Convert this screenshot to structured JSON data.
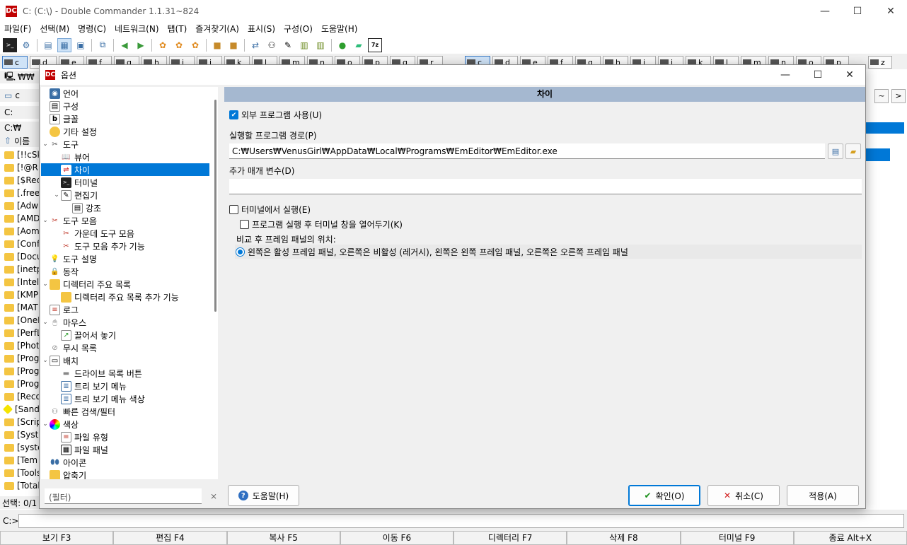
{
  "window": {
    "title": "C: (C:\\) - Double Commander 1.1.31~824",
    "minimize": "—",
    "maximize": "☐",
    "close": "✕"
  },
  "menu": [
    "파일(F)",
    "선택(M)",
    "명령(C)",
    "네트워크(N)",
    "탭(T)",
    "즐겨찾기(A)",
    "표시(S)",
    "구성(O)",
    "도움말(H)"
  ],
  "drives_left": [
    "c",
    "d",
    "e",
    "f",
    "g",
    "h",
    "i",
    "j",
    "k",
    "l",
    "m",
    "n",
    "o",
    "p",
    "q",
    "r",
    "s",
    "z"
  ],
  "drives_right": [
    "c",
    "d",
    "e",
    "f",
    "g",
    "h",
    "i",
    "j",
    "k",
    "l",
    "m",
    "n",
    "o",
    "p",
    "q",
    "r",
    "z"
  ],
  "left_panel": {
    "net_label": "₩₩",
    "drive_label": "c",
    "path_drive": "C:",
    "path": "C:₩",
    "column_name": "이름",
    "rows": [
      "[!!cSk",
      "[!@RI",
      "[$Rec",
      "[.free",
      "[Adw",
      "[AMD",
      "[Aom",
      "[Conf",
      "[Docu",
      "[inetp",
      "[Intel",
      "[KMP",
      "[MAT",
      "[OneI",
      "[PerfL",
      "[Phot",
      "[Prog",
      "[Prog",
      "[Prog",
      "[Reco",
      "[Sand",
      "[Scrip",
      "[Syste",
      "[syste",
      "[Tem",
      "[Tools",
      "[Total"
    ],
    "status": "선택: 0/1"
  },
  "dialog": {
    "title": "옵션",
    "minimize": "—",
    "maximize": "☐",
    "close": "✕",
    "tree": [
      {
        "label": "언어",
        "level": 0,
        "icon": "globe"
      },
      {
        "label": "구성",
        "level": 0,
        "icon": "doc"
      },
      {
        "label": "글꼴",
        "level": 0,
        "icon": "font"
      },
      {
        "label": "기타 설정",
        "level": 0,
        "icon": "misc"
      },
      {
        "label": "도구",
        "level": 0,
        "icon": "tools",
        "expanded": true
      },
      {
        "label": "뷰어",
        "level": 1,
        "icon": "book"
      },
      {
        "label": "차이",
        "level": 1,
        "icon": "diff",
        "selected": true
      },
      {
        "label": "터미널",
        "level": 1,
        "icon": "terminal"
      },
      {
        "label": "편집기",
        "level": 1,
        "icon": "edit",
        "expanded": true
      },
      {
        "label": "강조",
        "level": 2,
        "icon": "doc"
      },
      {
        "label": "도구 모음",
        "level": 0,
        "icon": "scissors",
        "expanded": true
      },
      {
        "label": "가운데 도구 모음",
        "level": 1,
        "icon": "scissors"
      },
      {
        "label": "도구 모음 추가 기능",
        "level": 1,
        "icon": "scissors"
      },
      {
        "label": "도구 설명",
        "level": 0,
        "icon": "bulb"
      },
      {
        "label": "동작",
        "level": 0,
        "icon": "lock"
      },
      {
        "label": "디렉터리 주요 목록",
        "level": 0,
        "icon": "folder",
        "expanded": true
      },
      {
        "label": "디렉터리 주요 목록 추가 기능",
        "level": 1,
        "icon": "folder"
      },
      {
        "label": "로그",
        "level": 0,
        "icon": "log"
      },
      {
        "label": "마우스",
        "level": 0,
        "icon": "mouse",
        "expanded": true
      },
      {
        "label": "끌어서 놓기",
        "level": 1,
        "icon": "drag"
      },
      {
        "label": "무시 목록",
        "level": 0,
        "icon": "ignore"
      },
      {
        "label": "배치",
        "level": 0,
        "icon": "layout",
        "expanded": true
      },
      {
        "label": "드라이브 목록 버튼",
        "level": 1,
        "icon": "drive"
      },
      {
        "label": "트리 보기 메뉴",
        "level": 1,
        "icon": "tree"
      },
      {
        "label": "트리 보기 메뉴 색상",
        "level": 1,
        "icon": "tree"
      },
      {
        "label": "빠른 검색/필터",
        "level": 0,
        "icon": "binoculars"
      },
      {
        "label": "색상",
        "level": 0,
        "icon": "colors",
        "expanded": true
      },
      {
        "label": "파일 유형",
        "level": 1,
        "icon": "filetype"
      },
      {
        "label": "파일 패널",
        "level": 1,
        "icon": "panel"
      },
      {
        "label": "아이콘",
        "level": 0,
        "icon": "icons"
      },
      {
        "label": "압축기",
        "level": 0,
        "icon": "archive"
      }
    ],
    "filter_placeholder": "(필터)",
    "help_button": "도움말(H)",
    "ok_button": "확인(O)",
    "cancel_button": "취소(C)",
    "apply_button": "적용(A)",
    "pane": {
      "header": "차이",
      "use_external": {
        "label": "외부 프로그램 사용(U)",
        "checked": true
      },
      "path_label": "실행할 프로그램 경로(P)",
      "path_value": "C:₩Users₩VenusGirl₩AppData₩Local₩Programs₩EmEditor₩EmEditor.exe",
      "params_label": "추가 매개 변수(D)",
      "params_value": "",
      "run_in_terminal": {
        "label": "터미널에서 실행(E)",
        "checked": false
      },
      "keep_terminal": {
        "label": "프로그램 실행 후 터미널 창을 열어두기(K)",
        "checked": false
      },
      "group_title": "비교 후 프레임 패널의 위치:",
      "frame_option": {
        "label": "왼쪽은 활성 프레임 패널, 오른쪽은 비활성 (레거시), 왼쪽은 왼쪽 프레임 패널, 오른쪽은 오른쪽 프레임 패널",
        "selected": true
      }
    }
  },
  "cmdline_label": "C:>",
  "fkeys": [
    "보기 F3",
    "편집 F4",
    "복사 F5",
    "이동 F6",
    "디렉터리 F7",
    "삭제 F8",
    "터미널 F9",
    "종료 Alt+X"
  ]
}
